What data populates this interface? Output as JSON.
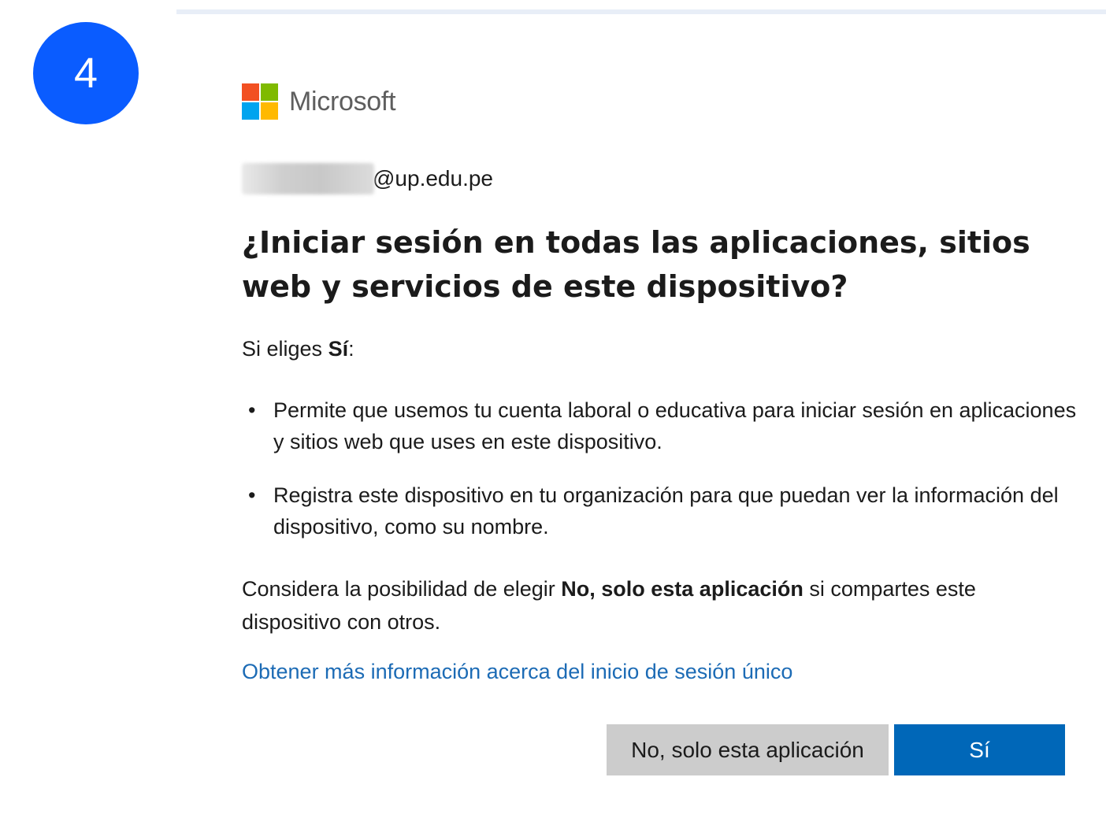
{
  "step": {
    "number": "4"
  },
  "brand": {
    "name": "Microsoft",
    "logo_colors": [
      "#f25022",
      "#7fba00",
      "#00a4ef",
      "#ffb900"
    ]
  },
  "account": {
    "domain": "@up.edu.pe"
  },
  "title": "¿Iniciar sesión en todas las aplicaciones, sitios web y servicios de este dispositivo?",
  "intro": {
    "prefix": "Si eliges ",
    "bold": "Sí",
    "suffix": ":"
  },
  "bullets": [
    "Permite que usemos tu cuenta laboral o educativa para iniciar sesión en aplicaciones y sitios web que uses en este dispositivo.",
    "Registra este dispositivo en tu organización para que puedan ver la información del dispositivo, como su nombre."
  ],
  "note": {
    "prefix": "Considera la posibilidad de elegir ",
    "bold": "No, solo esta aplicación",
    "suffix": " si compartes este dispositivo con otros."
  },
  "learn_more_link": "Obtener más información acerca del inicio de sesión único",
  "buttons": {
    "secondary": "No, solo esta aplicación",
    "primary": "Sí"
  },
  "colors": {
    "badge": "#0a5cff",
    "primary_button": "#0067b8",
    "secondary_button": "#cccccc",
    "link": "#1c6bb5"
  }
}
